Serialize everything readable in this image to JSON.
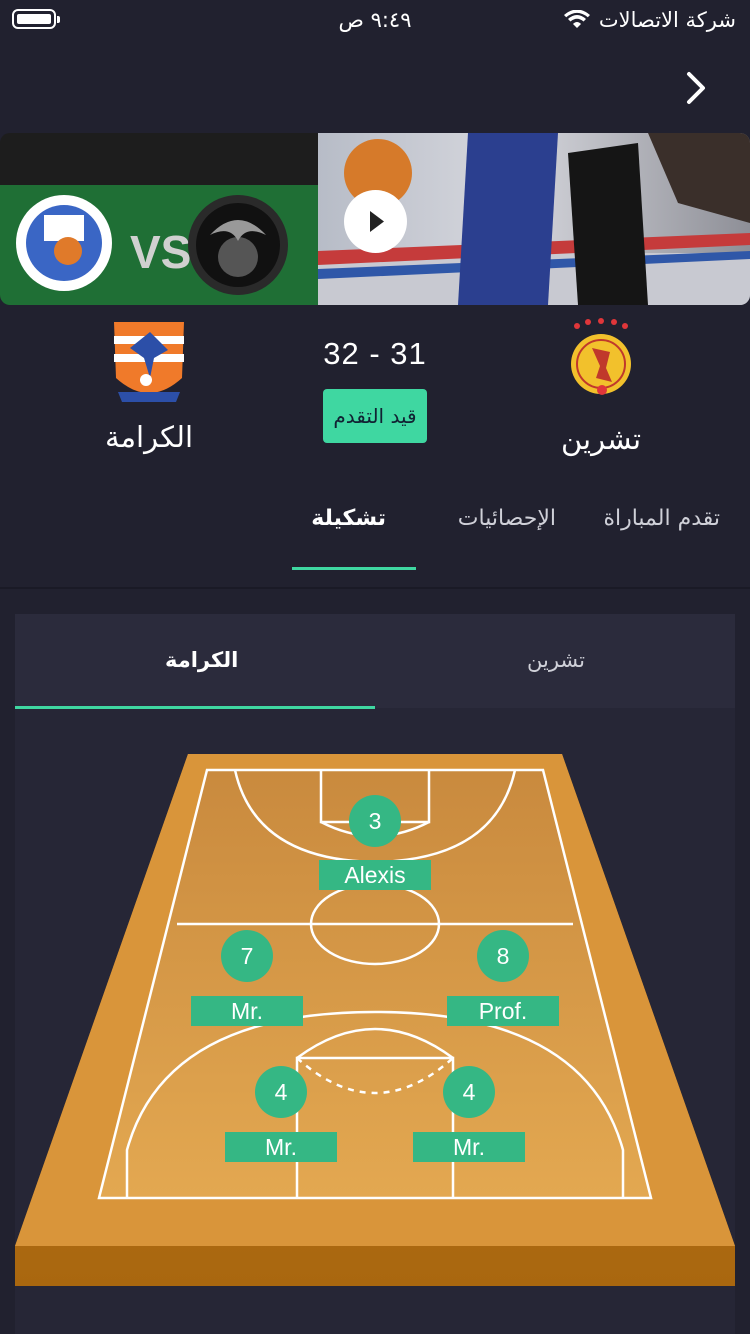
{
  "status_bar": {
    "time": "٩:٤٩ ص",
    "carrier": "شركة الاتصالات"
  },
  "match": {
    "home_team": "تشرين",
    "away_team": "الكرامة",
    "score": "32 - 31",
    "status": "قيد التقدم"
  },
  "thumbnail": {
    "vs": "VS"
  },
  "tabs": [
    {
      "label": "تقدم المباراة"
    },
    {
      "label": "الإحصائيات"
    },
    {
      "label": "تشكيلة",
      "active": true
    }
  ],
  "lineup": {
    "team_tabs": [
      {
        "label": "تشرين"
      },
      {
        "label": "الكرامة",
        "active": true
      }
    ],
    "players": [
      {
        "number": "3",
        "name": "Alexis"
      },
      {
        "number": "7",
        "name": "Mr."
      },
      {
        "number": "8",
        "name": "Prof."
      },
      {
        "number": "4",
        "name": "Mr."
      },
      {
        "number": "4",
        "name": "Mr."
      }
    ]
  },
  "colors": {
    "accent": "#3fd7a1",
    "player_badge": "#35b784",
    "background": "#21212f"
  }
}
